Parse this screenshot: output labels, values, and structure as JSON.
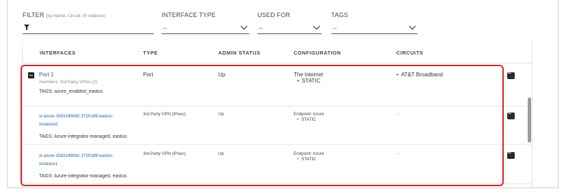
{
  "filters": {
    "filter_label": "FILTER",
    "filter_hint": "(by Name, Circuit, IP Address)",
    "interface_type_label": "INTERFACE TYPE",
    "interface_type_value": "--",
    "used_for_label": "USED FOR",
    "used_for_value": "--",
    "tags_label": "TAGS",
    "tags_value": "--"
  },
  "table": {
    "columns": [
      "INTERFACES",
      "TYPE",
      "ADMIN STATUS",
      "CONFIGURATION",
      "CIRCUITS"
    ],
    "rows": [
      {
        "name": "Port 1",
        "members": "members: 3rd Party VPNs (2)",
        "tags": "TAGS: azure_enabled_eastus",
        "type": "Port",
        "admin_status": "Up",
        "config_title": "The Internet",
        "config_item": "STATIC",
        "circuit": "AT&T Broadband"
      },
      {
        "name_line1": "sl-azure-1583186062 3720189-eastus-",
        "name_line2": "Instance0",
        "tags": "TAGS: Azure-integrator-managed, eastus",
        "type": "3rd Party VPN (IPsec)",
        "admin_status": "Up",
        "config_title": "Endpoint: Azure",
        "config_item": "STATIC",
        "circuit": "--"
      },
      {
        "name_line1": "sl-azure-1583186062 3720189-eastus-",
        "name_line2": "Instance1",
        "tags": "TAGS: Azure-integrator-managed, eastus",
        "type": "3rd Party VPN (IPsec)",
        "admin_status": "Up",
        "config_title": "Endpoint: Azure",
        "config_item": "STATIC",
        "circuit": "--"
      }
    ]
  },
  "colors": {
    "highlight": "#e02020",
    "link": "#1a5fa8"
  }
}
